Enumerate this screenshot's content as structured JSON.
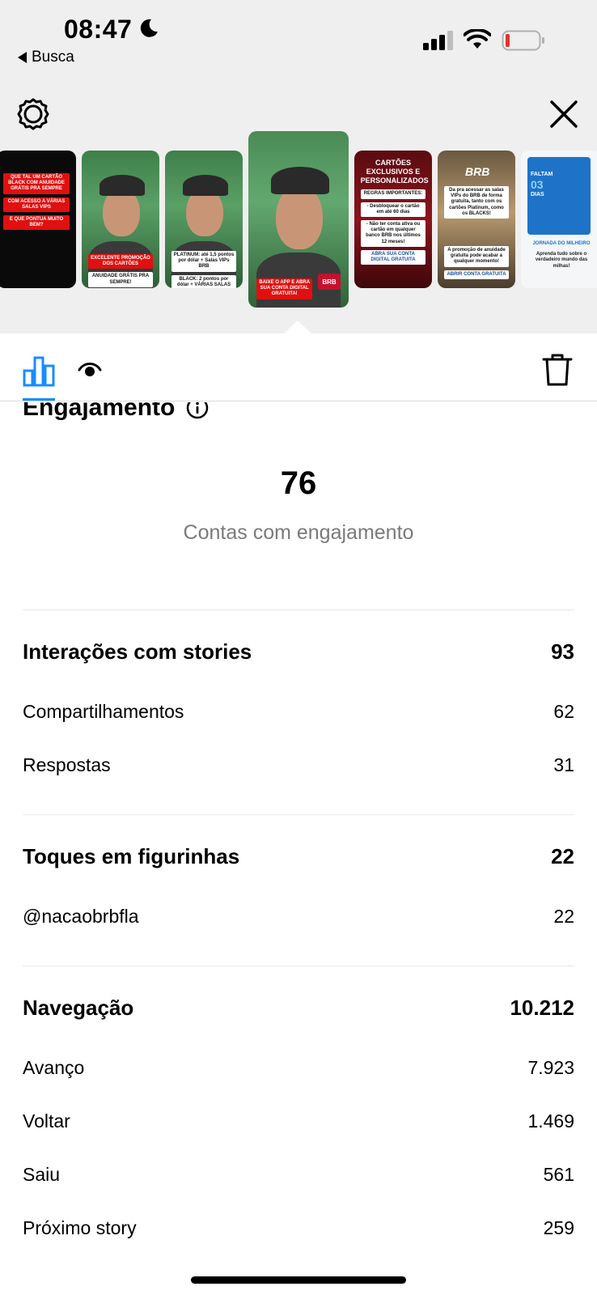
{
  "status_bar": {
    "time": "08:47",
    "back_label": "Busca",
    "battery_color": "#e5332a"
  },
  "toolbar": {
    "active_tab_color": "#1a8cff"
  },
  "stories": [
    {
      "texts": [
        "QUE TAL UM CARTÃO BLACK COM ANUIDADE GRÁTIS PRA SEMPRE",
        "COM ACESSO A VÁRIAS SALAS VIPS",
        "E QUE PONTUA MUITO BEM?"
      ]
    },
    {
      "texts": [
        "EXCELENTE PROMOÇÃO DOS CARTÕES",
        "ANUIDADE GRÁTIS PRA SEMPRE!"
      ]
    },
    {
      "texts": [
        "PLATINUM: até 1,5 pontos por dólar + Salas VIPs BRB",
        "BLACK: 2 pontos por dólar + VÁRIAS SALAS VIPS"
      ]
    },
    {
      "texts": [
        "BAIXE O APP E ABRA SUA CONTA DIGITAL GRATUITA!"
      ],
      "logo": "BRB"
    },
    {
      "texts": [
        "CARTÕES EXCLUSIVOS E PERSONALIZADOS",
        "REGRAS IMPORTANTES:",
        "- Desbloquear o cartão em até 60 dias",
        "- Não ter conta ativa ou cartão em qualquer banco BRB nos últimos 12 meses!",
        "ABRA SUA CONTA DIGITAL GRATUITA"
      ]
    },
    {
      "texts": [
        "Da pra acessar as salas VIPs do BRB de forma gratuita, tanto com os cartões Platinum, como os BLACKS!",
        "A promoção de anuidade gratuita pode acabar a qualquer momento!",
        "ABRIR CONTA GRATUITA"
      ],
      "logo": "BRB"
    },
    {
      "texts": [
        "FALTAM",
        "03",
        "DIAS",
        "JORNADA DO MILHEIRO",
        "Aprenda tudo sobre o verdadeiro mundo das milhas!"
      ]
    }
  ],
  "engagement": {
    "title": "Engajamento",
    "accounts_count": "76",
    "accounts_label": "Contas com engajamento"
  },
  "interactions": {
    "title": "Interações com stories",
    "total": "93",
    "rows": [
      {
        "label": "Compartilhamentos",
        "value": "62"
      },
      {
        "label": "Respostas",
        "value": "31"
      }
    ]
  },
  "stickers": {
    "title": "Toques em figurinhas",
    "total": "22",
    "rows": [
      {
        "label": "@nacaobrbfla",
        "value": "22"
      }
    ]
  },
  "navigation": {
    "title": "Navegação",
    "total": "10.212",
    "rows": [
      {
        "label": "Avanço",
        "value": "7.923"
      },
      {
        "label": "Voltar",
        "value": "1.469"
      },
      {
        "label": "Saiu",
        "value": "561"
      },
      {
        "label": "Próximo story",
        "value": "259"
      }
    ]
  }
}
